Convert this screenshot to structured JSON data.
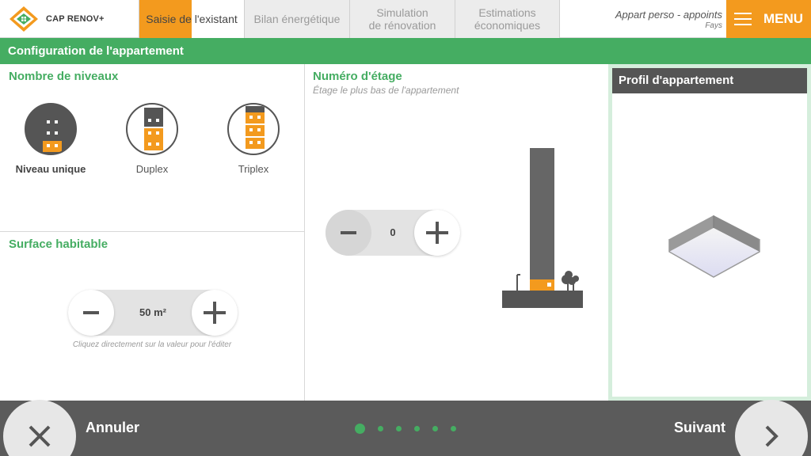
{
  "app": {
    "name": "CAP RENOV+"
  },
  "tabs": [
    {
      "label": "Saisie de l'existant",
      "active": true,
      "progress_fraction": 0.5
    },
    {
      "label": "Bilan énergétique",
      "active": false
    },
    {
      "label": "Simulation\nde rénovation",
      "active": false
    },
    {
      "label": "Estimations\néconomiques",
      "active": false
    }
  ],
  "project": {
    "name": "Appart perso - appoints",
    "subtitle": "Fays"
  },
  "menu": {
    "label": "MENU"
  },
  "section": {
    "title": "Configuration de l'appartement"
  },
  "levels": {
    "title": "Nombre de niveaux",
    "options": [
      {
        "label": "Niveau unique",
        "selected": true,
        "floors": 1
      },
      {
        "label": "Duplex",
        "selected": false,
        "floors": 2
      },
      {
        "label": "Triplex",
        "selected": false,
        "floors": 3
      }
    ]
  },
  "surface": {
    "title": "Surface habitable",
    "value": "50 m²",
    "hint": "Cliquez directement sur la valeur pour l'éditer"
  },
  "floor": {
    "title": "Numéro d'étage",
    "subtitle": "Étage le plus bas de l'appartement",
    "value": "0"
  },
  "profile": {
    "title": "Profil d'appartement"
  },
  "footer": {
    "cancel_label": "Annuler",
    "next_label": "Suivant",
    "steps_total": 6,
    "current_step": 1
  },
  "colors": {
    "green": "#45ad62",
    "orange": "#f39a1e",
    "dark": "#555555"
  }
}
